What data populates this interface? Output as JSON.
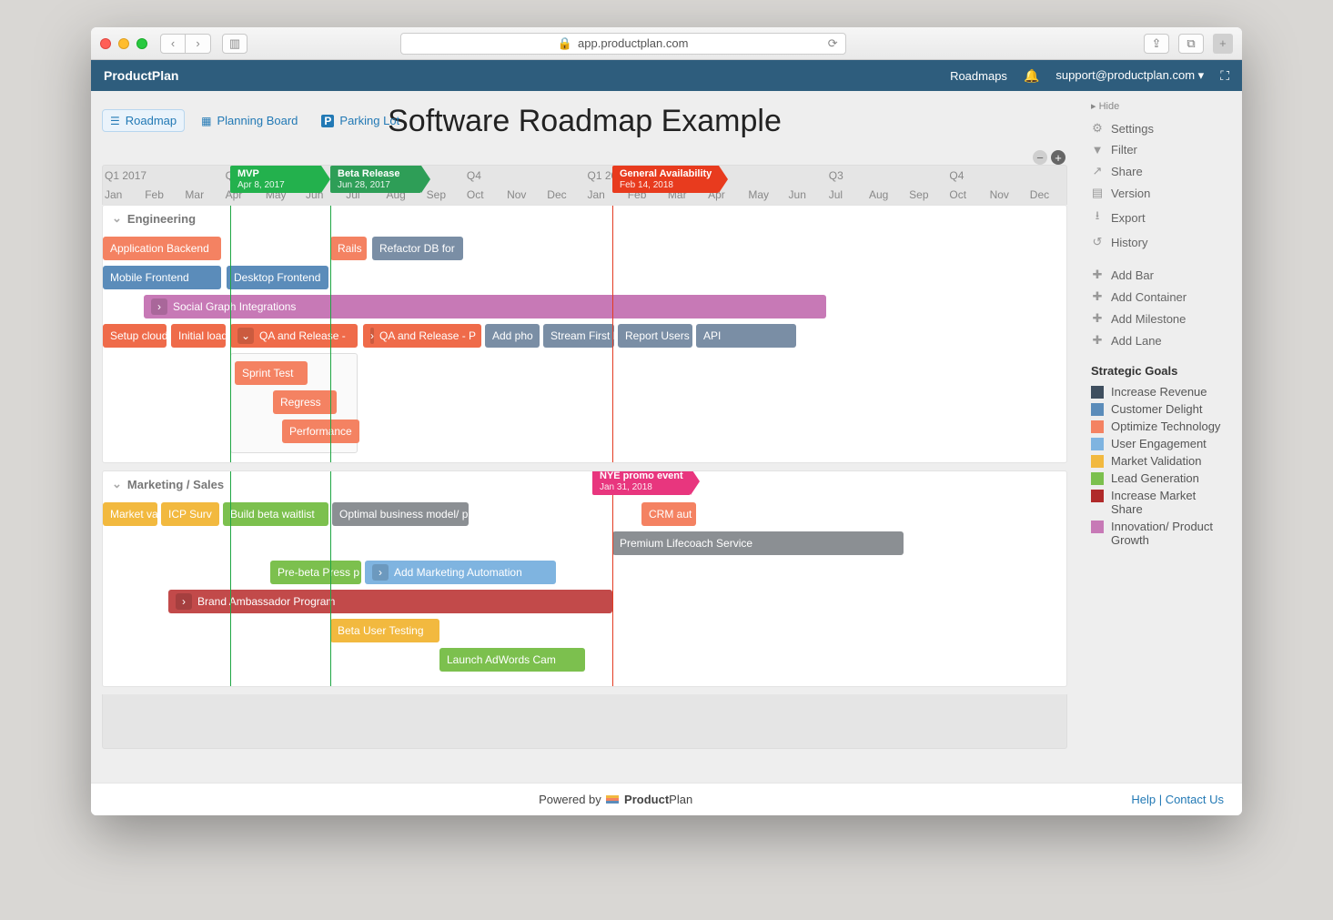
{
  "browser": {
    "url": "app.productplan.com"
  },
  "appbar": {
    "brand": "ProductPlan",
    "roadmaps": "Roadmaps",
    "user": "support@productplan.com"
  },
  "title": "Software Roadmap Example",
  "tabs": {
    "roadmap": "Roadmap",
    "planning": "Planning Board",
    "parking": "Parking Lot"
  },
  "timeline": {
    "quarters": [
      "Q1 2017",
      "Q2",
      "Q3",
      "Q4",
      "Q1 2018",
      "Q2",
      "Q3",
      "Q4"
    ],
    "months": [
      "Jan",
      "Feb",
      "Mar",
      "Apr",
      "May",
      "Jun",
      "Jul",
      "Aug",
      "Sep",
      "Oct",
      "Nov",
      "Dec",
      "Jan",
      "Feb",
      "Mar",
      "Apr",
      "May",
      "Jun",
      "Jul",
      "Aug",
      "Sep",
      "Oct",
      "Nov",
      "Dec"
    ]
  },
  "milestones": {
    "mvp": {
      "title": "MVP",
      "date": "Apr 8, 2017"
    },
    "beta": {
      "title": "Beta Release",
      "date": "Jun 28, 2017"
    },
    "ga": {
      "title": "General Availability",
      "date": "Feb 14, 2018"
    },
    "nye": {
      "title": "NYE promo event",
      "date": "Jan 31, 2018"
    }
  },
  "lanes": {
    "engineering": {
      "title": "Engineering",
      "bars": {
        "app_backend": "Application Backend",
        "rails": "Rails",
        "refactor": "Refactor DB for",
        "mobile": "Mobile Frontend",
        "desktop": "Desktop Frontend",
        "social": "Social Graph Integrations",
        "setup": "Setup cloud",
        "initial": "Initial load",
        "qa1": "QA and Release -",
        "qa2": "QA and Release - P",
        "addpho": "Add pho",
        "stream": "Stream First D",
        "report": "Report Users",
        "api": "API",
        "sprint": "Sprint Test",
        "regress": "Regress",
        "perf": "Performance"
      }
    },
    "marketing": {
      "title": "Marketing / Sales",
      "bars": {
        "market_val": "Market val",
        "icp": "ICP Surv",
        "waitlist": "Build beta waitlist",
        "optimal": "Optimal business model/ pr",
        "crm": "CRM aut",
        "premium": "Premium Lifecoach Service",
        "prebeta": "Pre-beta Press p",
        "mktgauto": "Add Marketing Automation",
        "brand": "Brand Ambassador Program",
        "betauser": "Beta User Testing",
        "adwords": "Launch AdWords Cam"
      }
    }
  },
  "sidepanel": {
    "hide": "Hide",
    "tools": {
      "settings": "Settings",
      "filter": "Filter",
      "share": "Share",
      "version": "Version",
      "export": "Export",
      "history": "History"
    },
    "add": {
      "bar": "Add Bar",
      "container": "Add Container",
      "milestone": "Add Milestone",
      "lane": "Add Lane"
    },
    "legend_title": "Strategic Goals",
    "legend": [
      {
        "label": "Increase Revenue",
        "color": "#3e4e5e"
      },
      {
        "label": "Customer Delight",
        "color": "#5b8cba"
      },
      {
        "label": "Optimize Technology",
        "color": "#f48262"
      },
      {
        "label": "User Engagement",
        "color": "#7fb4e0"
      },
      {
        "label": "Market Validation",
        "color": "#f2b93f"
      },
      {
        "label": "Lead Generation",
        "color": "#7cc04e"
      },
      {
        "label": "Increase Market Share",
        "color": "#b02a2a"
      },
      {
        "label": "Innovation/ Product Growth",
        "color": "#c779b6"
      }
    ]
  },
  "footer": {
    "powered": "Powered by",
    "brand1": "Product",
    "brand2": "Plan",
    "help": "Help",
    "contact": "Contact Us"
  }
}
